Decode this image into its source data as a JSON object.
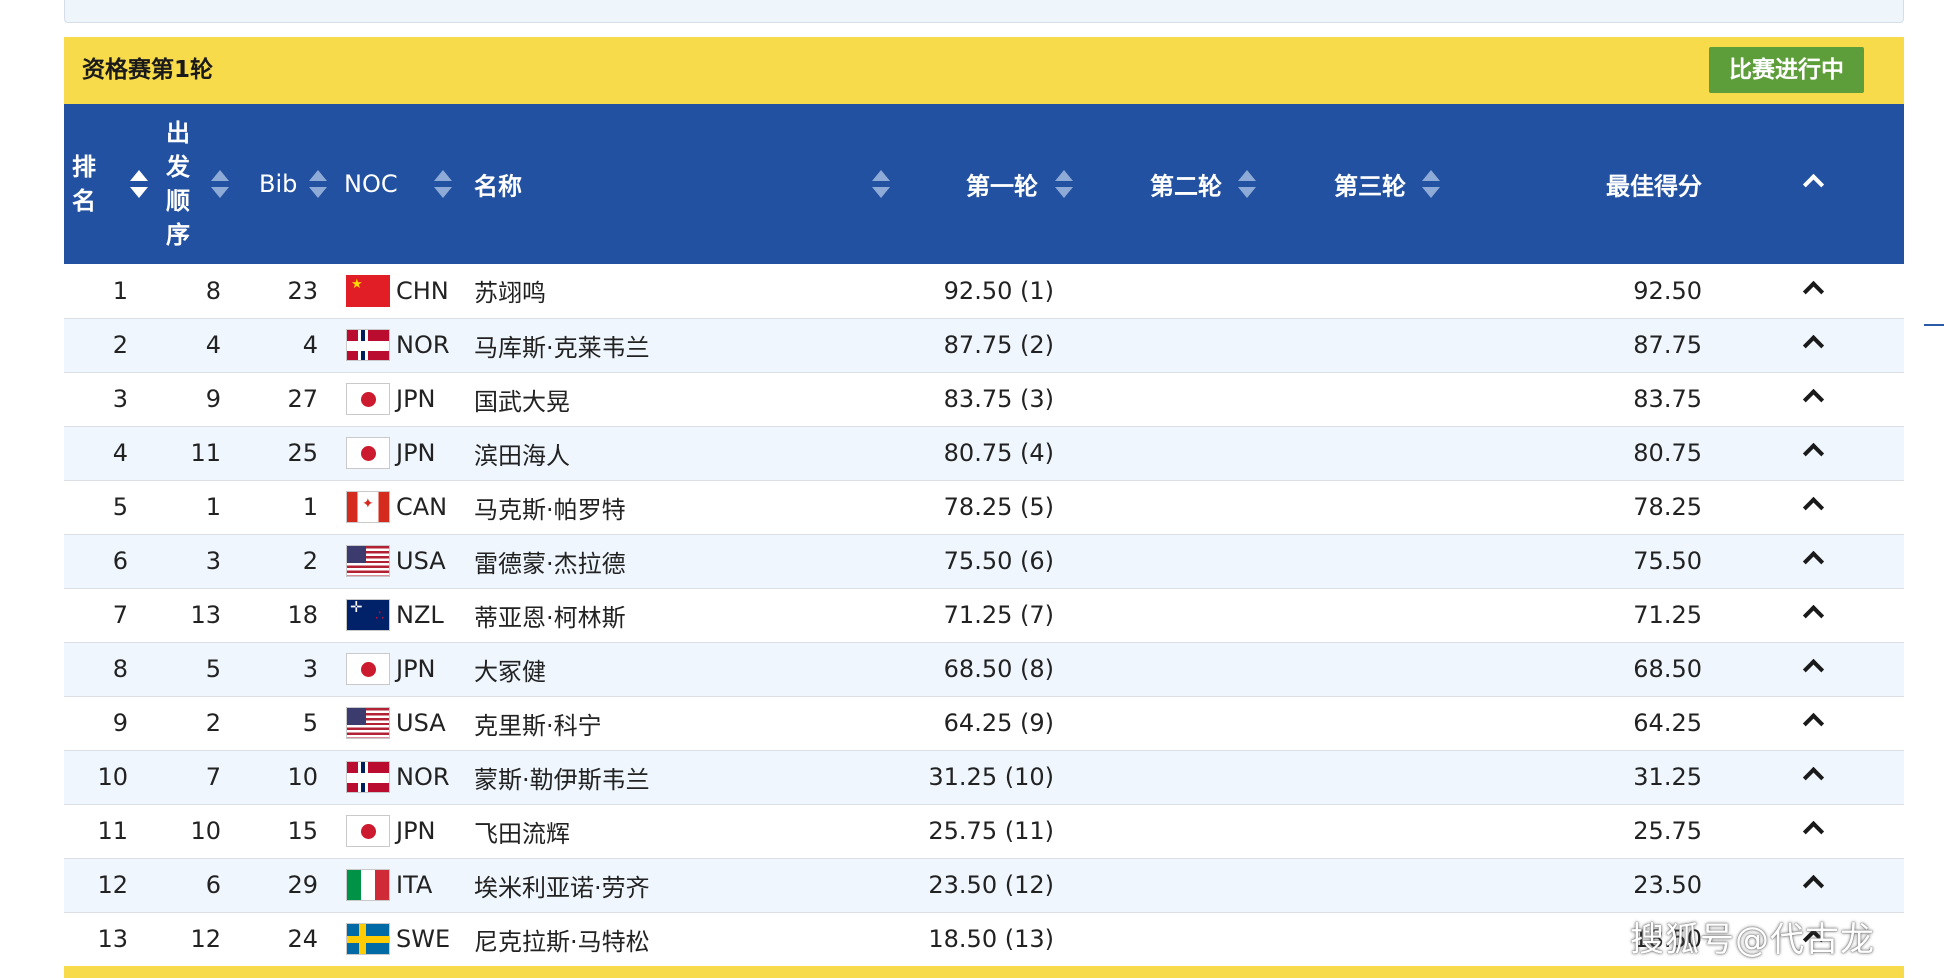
{
  "round": {
    "title": "资格赛第1轮",
    "status_label": "比赛进行中"
  },
  "columns": {
    "rank": "排名",
    "order": "出发顺序",
    "bib": "Bib",
    "noc": "NOC",
    "name": "名称",
    "r1": "第一轮",
    "r2": "第二轮",
    "r3": "第三轮",
    "best": "最佳得分"
  },
  "rows": [
    {
      "rank": "1",
      "order": "8",
      "bib": "23",
      "noc": "CHN",
      "flag": "flag-chn",
      "name": "苏翊鸣",
      "r1": "92.50 (1)",
      "best": "92.50"
    },
    {
      "rank": "2",
      "order": "4",
      "bib": "4",
      "noc": "NOR",
      "flag": "flag-nor",
      "name": "马库斯·克莱韦兰",
      "r1": "87.75 (2)",
      "best": "87.75"
    },
    {
      "rank": "3",
      "order": "9",
      "bib": "27",
      "noc": "JPN",
      "flag": "flag-jpn",
      "name": "国武大晃",
      "r1": "83.75 (3)",
      "best": "83.75"
    },
    {
      "rank": "4",
      "order": "11",
      "bib": "25",
      "noc": "JPN",
      "flag": "flag-jpn",
      "name": "滨田海人",
      "r1": "80.75 (4)",
      "best": "80.75"
    },
    {
      "rank": "5",
      "order": "1",
      "bib": "1",
      "noc": "CAN",
      "flag": "flag-can",
      "name": "马克斯·帕罗特",
      "r1": "78.25 (5)",
      "best": "78.25"
    },
    {
      "rank": "6",
      "order": "3",
      "bib": "2",
      "noc": "USA",
      "flag": "flag-usa",
      "name": "雷德蒙·杰拉德",
      "r1": "75.50 (6)",
      "best": "75.50"
    },
    {
      "rank": "7",
      "order": "13",
      "bib": "18",
      "noc": "NZL",
      "flag": "flag-nzl",
      "name": "蒂亚恩·柯林斯",
      "r1": "71.25 (7)",
      "best": "71.25"
    },
    {
      "rank": "8",
      "order": "5",
      "bib": "3",
      "noc": "JPN",
      "flag": "flag-jpn",
      "name": "大冢健",
      "r1": "68.50 (8)",
      "best": "68.50"
    },
    {
      "rank": "9",
      "order": "2",
      "bib": "5",
      "noc": "USA",
      "flag": "flag-usa",
      "name": "克里斯·科宁",
      "r1": "64.25 (9)",
      "best": "64.25"
    },
    {
      "rank": "10",
      "order": "7",
      "bib": "10",
      "noc": "NOR",
      "flag": "flag-nor",
      "name": "蒙斯·勒伊斯韦兰",
      "r1": "31.25 (10)",
      "best": "31.25"
    },
    {
      "rank": "11",
      "order": "10",
      "bib": "15",
      "noc": "JPN",
      "flag": "flag-jpn",
      "name": "飞田流辉",
      "r1": "25.75 (11)",
      "best": "25.75"
    },
    {
      "rank": "12",
      "order": "6",
      "bib": "29",
      "noc": "ITA",
      "flag": "flag-ita",
      "name": "埃米利亚诺·劳齐",
      "r1": "23.50 (12)",
      "best": "23.50"
    },
    {
      "rank": "13",
      "order": "12",
      "bib": "24",
      "noc": "SWE",
      "flag": "flag-swe",
      "name": "尼克拉斯·马特松",
      "r1": "18.50 (13)",
      "best": "18.50"
    }
  ],
  "watermark": "搜狐号@代古龙",
  "icons": {
    "sort": "sort-icon",
    "expand": "chevron-up-icon"
  },
  "colors": {
    "header_blue": "#2351a1",
    "round_yellow": "#f7db4a",
    "status_green": "#5e9e3a",
    "row_alt": "#eff6fd"
  }
}
